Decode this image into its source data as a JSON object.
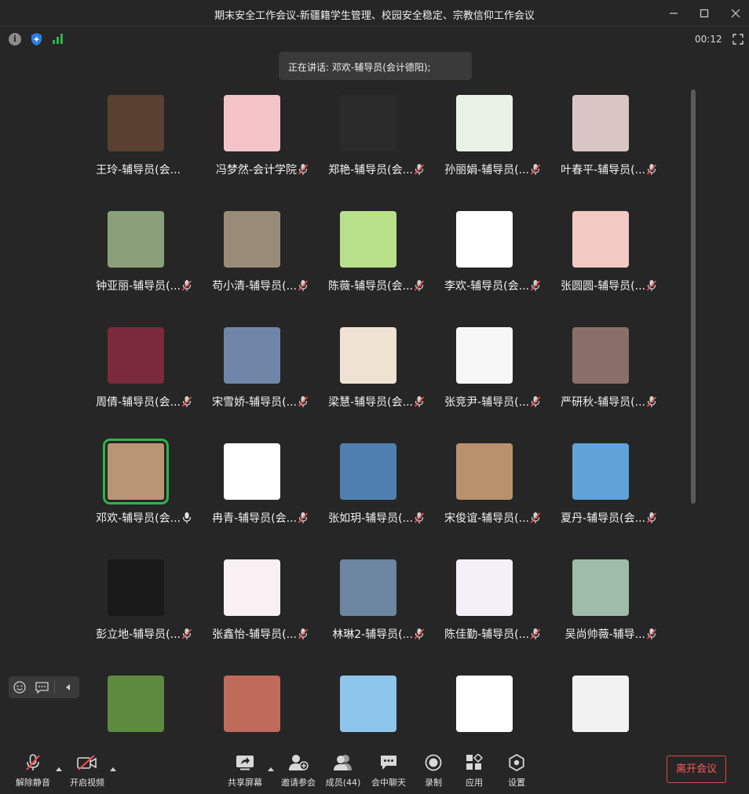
{
  "window": {
    "title": "期末安全工作会议-新疆籍学生管理、校园安全稳定、宗教信仰工作会议"
  },
  "status": {
    "timer": "00:12"
  },
  "speaking": {
    "text": "正在讲话: 邓欢-辅导员(会计德阳);"
  },
  "participants": [
    {
      "name": "王玲-辅导员(会...",
      "mic": "none",
      "color": "#5a4030"
    },
    {
      "name": "冯梦然-会计学院",
      "mic": "muted",
      "color": "#f4c3c8"
    },
    {
      "name": "郑艳-辅导员(会...",
      "mic": "muted",
      "color": "#2b2b2b"
    },
    {
      "name": "孙丽娟-辅导员(...",
      "mic": "muted",
      "color": "#e9f2e4"
    },
    {
      "name": "叶春平-辅导员(...",
      "mic": "muted",
      "color": "#d9c6c3"
    },
    {
      "name": "钟亚丽-辅导员(...",
      "mic": "muted",
      "color": "#8aa07a"
    },
    {
      "name": "苟小清-辅导员(...",
      "mic": "muted",
      "color": "#9a8b78"
    },
    {
      "name": "陈薇-辅导员(会...",
      "mic": "muted",
      "color": "#b9e08a"
    },
    {
      "name": "李欢-辅导员(会...",
      "mic": "muted",
      "color": "#ffffff"
    },
    {
      "name": "张圆圆-辅导员(...",
      "mic": "muted",
      "color": "#f3c9c4"
    },
    {
      "name": "周倩-辅导员(会...",
      "mic": "muted",
      "color": "#7a2a3a"
    },
    {
      "name": "宋雪娇-辅导员(...",
      "mic": "muted",
      "color": "#6f86a8"
    },
    {
      "name": "梁慧-辅导员(会...",
      "mic": "muted",
      "color": "#efe2d2"
    },
    {
      "name": "张竞尹-辅导员(...",
      "mic": "muted",
      "color": "#f7f7f7"
    },
    {
      "name": "严研秋-辅导员(...",
      "mic": "muted",
      "color": "#8a6f68"
    },
    {
      "name": "邓欢-辅导员(会...",
      "mic": "active",
      "color": "#b99576"
    },
    {
      "name": "冉青-辅导员(会...",
      "mic": "muted",
      "color": "#ffffff"
    },
    {
      "name": "张如玥-辅导员(...",
      "mic": "muted",
      "color": "#4f7fb0"
    },
    {
      "name": "宋俊谊-辅导员(...",
      "mic": "muted",
      "color": "#b8926c"
    },
    {
      "name": "夏丹-辅导员(会...",
      "mic": "muted",
      "color": "#5fa3d8"
    },
    {
      "name": "彭立地-辅导员(...",
      "mic": "muted",
      "color": "#1a1a1a"
    },
    {
      "name": "张鑫怡-辅导员(...",
      "mic": "muted",
      "color": "#f8f0f3"
    },
    {
      "name": "林琳2-辅导员(...",
      "mic": "muted",
      "color": "#6c85a0"
    },
    {
      "name": "陈佳勤-辅导员(...",
      "mic": "muted",
      "color": "#f4f0f8"
    },
    {
      "name": "吴尚帅薇-辅导...",
      "mic": "muted",
      "color": "#9fbca8"
    },
    {
      "name": "",
      "mic": "none",
      "color": "#5d8a3e"
    },
    {
      "name": "",
      "mic": "none",
      "color": "#c06a5a"
    },
    {
      "name": "",
      "mic": "none",
      "color": "#8dc6ec"
    },
    {
      "name": "",
      "mic": "none",
      "color": "#ffffff"
    },
    {
      "name": "",
      "mic": "none",
      "color": "#f2f2f2"
    }
  ],
  "toolbar": {
    "unmute": "解除静音",
    "start_video": "开启视频",
    "share_screen": "共享屏幕",
    "invite": "邀请参会",
    "members": "成员(44)",
    "chat": "会中聊天",
    "record": "录制",
    "apps": "应用",
    "settings": "设置",
    "leave": "离开会议"
  },
  "colors": {
    "background": "#262626",
    "active_speaker": "#2db54a",
    "leave_red": "#ff5a5a",
    "shield_blue": "#2f7be6",
    "signal_green": "#2db54a"
  }
}
